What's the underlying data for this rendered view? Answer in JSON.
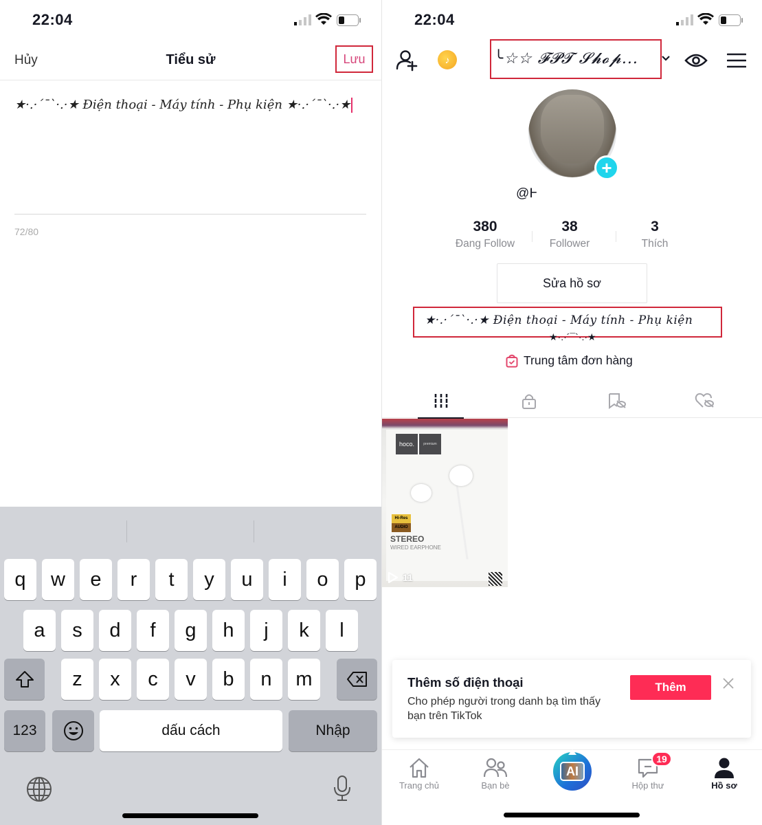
{
  "left": {
    "status": {
      "time": "22:04"
    },
    "header": {
      "cancel": "Hủy",
      "title": "Tiểu sử",
      "save": "Lưu"
    },
    "editor": {
      "value": "★·.·´¯`·.·★ Điện thoại - Máy tính - Phụ kiện ★·.·´¯`·.·★",
      "counter": "72/80"
    },
    "keyboard": {
      "row1": [
        "q",
        "w",
        "e",
        "r",
        "t",
        "y",
        "u",
        "i",
        "o",
        "p"
      ],
      "row2": [
        "a",
        "s",
        "d",
        "f",
        "g",
        "h",
        "j",
        "k",
        "l"
      ],
      "row3": [
        "z",
        "x",
        "c",
        "v",
        "b",
        "n",
        "m"
      ],
      "numbers": "123",
      "space": "dấu cách",
      "return": "Nhập"
    }
  },
  "right": {
    "status": {
      "time": "22:04"
    },
    "header": {
      "username": "╰☆☆ 𝓕𝓟𝓣 𝓢𝓱𝓸𝓹...",
      "coin_label": "♪"
    },
    "profile": {
      "handle": "@Ͱ",
      "stats": [
        {
          "value": "380",
          "label": "Đang Follow"
        },
        {
          "value": "38",
          "label": "Follower"
        },
        {
          "value": "3",
          "label": "Thích"
        }
      ],
      "edit_button": "Sửa hồ sơ",
      "bio_line1": "★·.·´¯`·.·★ Điện thoại - Máy tính - Phụ kiện",
      "bio_line2": "★·.·´¯`·.·★",
      "orders": "Trung tâm đơn hàng"
    },
    "tabs": [
      "videos-grid",
      "private",
      "saved",
      "liked"
    ],
    "video": {
      "brand": "hoco.",
      "brand_sub": "premium",
      "hires": "Hi-Res AUDIO",
      "title": "STEREO",
      "subtitle": "WIRED EARPHONE",
      "plays": "11"
    },
    "banner": {
      "title": "Thêm số điện thoại",
      "description": "Cho phép người trong danh bạ tìm thấy bạn trên TikTok",
      "button": "Thêm"
    },
    "nav": {
      "items": [
        {
          "label": "Trang chủ",
          "icon": "home-icon"
        },
        {
          "label": "Bạn bè",
          "icon": "friends-icon"
        },
        {
          "label": "AI",
          "icon": "create-ai-icon"
        },
        {
          "label": "Hộp thư",
          "icon": "inbox-icon"
        },
        {
          "label": "Hồ sơ",
          "icon": "profile-icon"
        }
      ],
      "inbox_badge": "19"
    }
  },
  "colors": {
    "accent": "#fe2c55",
    "highlight_border": "#d0273a",
    "avatar_add": "#20d5ec",
    "keyboard_bg": "#d2d4d9"
  }
}
